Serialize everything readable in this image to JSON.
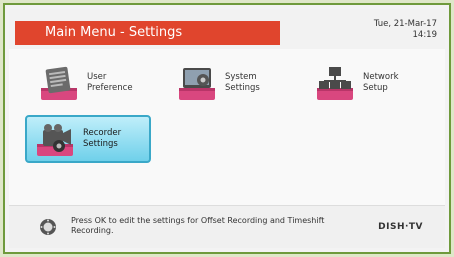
{
  "header": {
    "title": "Main Menu - Settings",
    "date": "Tue, 21-Mar-17",
    "time": "14:19"
  },
  "menu": {
    "items": [
      {
        "label": "User\nPreference",
        "icon": "user-preference-icon",
        "selected": false
      },
      {
        "label": "System\nSettings",
        "icon": "system-settings-icon",
        "selected": false
      },
      {
        "label": "Network\nSetup",
        "icon": "network-setup-icon",
        "selected": false
      },
      {
        "label": "Recorder\nSettings",
        "icon": "recorder-settings-icon",
        "selected": true
      }
    ]
  },
  "footer": {
    "hint": "Press OK to edit the settings for Offset Recording and Timeshift Recording.",
    "brand": "DISH·TV"
  },
  "colors": {
    "title_bar": "#e0452d",
    "selected_tile": "#6fd0ea",
    "frame": "#6f9a3c",
    "icon_base": "#d9477f"
  }
}
